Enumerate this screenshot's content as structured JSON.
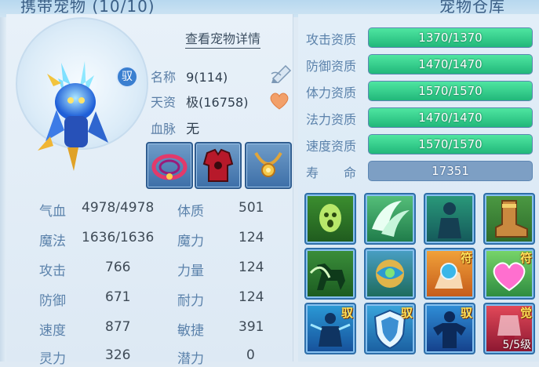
{
  "top": {
    "left_title": "携带宠物 (10/10)",
    "right_title": "宠物仓库"
  },
  "pet": {
    "badge": "驭",
    "details_link": "查看宠物详情",
    "name_label": "名称",
    "name_value": "9(114)",
    "aptitude_label": "天资",
    "aptitude_value": "极(16758)",
    "bloodline_label": "血脉",
    "bloodline_value": "无"
  },
  "equipment": [
    {
      "name": "collar-equip"
    },
    {
      "name": "armor-equip"
    },
    {
      "name": "necklace-equip"
    }
  ],
  "attributes": {
    "left": [
      {
        "label": "气血",
        "value": "4978/4978"
      },
      {
        "label": "魔法",
        "value": "1636/1636"
      },
      {
        "label": "攻击",
        "value": "766"
      },
      {
        "label": "防御",
        "value": "671"
      },
      {
        "label": "速度",
        "value": "877"
      },
      {
        "label": "灵力",
        "value": "326"
      }
    ],
    "right": [
      {
        "label": "体质",
        "value": "501"
      },
      {
        "label": "魔力",
        "value": "124"
      },
      {
        "label": "力量",
        "value": "124"
      },
      {
        "label": "耐力",
        "value": "124"
      },
      {
        "label": "敏捷",
        "value": "391"
      },
      {
        "label": "潜力",
        "value": "0"
      }
    ]
  },
  "qualities": [
    {
      "label": "攻击资质",
      "value": "1370/1370",
      "fill": 1.0
    },
    {
      "label": "防御资质",
      "value": "1470/1470",
      "fill": 1.0
    },
    {
      "label": "体力资质",
      "value": "1570/1570",
      "fill": 1.0
    },
    {
      "label": "法力资质",
      "value": "1470/1470",
      "fill": 1.0
    },
    {
      "label": "速度资质",
      "value": "1570/1570",
      "fill": 1.0
    }
  ],
  "life": {
    "label": "寿　　命",
    "value": "17351"
  },
  "skills": [
    {
      "name": "ghost-skill",
      "tag": "",
      "level": ""
    },
    {
      "name": "wing-skill",
      "tag": "",
      "level": ""
    },
    {
      "name": "shadow-skill",
      "tag": "",
      "level": ""
    },
    {
      "name": "boot-skill",
      "tag": "",
      "level": ""
    },
    {
      "name": "horse-skill",
      "tag": "",
      "level": ""
    },
    {
      "name": "orb-skill",
      "tag": "",
      "level": ""
    },
    {
      "name": "hand-skill",
      "tag": "符",
      "level": ""
    },
    {
      "name": "heart-skill",
      "tag": "符",
      "level": ""
    },
    {
      "name": "warrior-skill",
      "tag": "驭",
      "level": ""
    },
    {
      "name": "shield-skill",
      "tag": "驭",
      "level": ""
    },
    {
      "name": "muscle-skill",
      "tag": "驭",
      "level": ""
    },
    {
      "name": "awaken-skill",
      "tag": "觉",
      "level": "5/5级"
    }
  ],
  "colors": {
    "quality_fill": "#2fcb8a",
    "label_blue": "#5b82ab"
  }
}
